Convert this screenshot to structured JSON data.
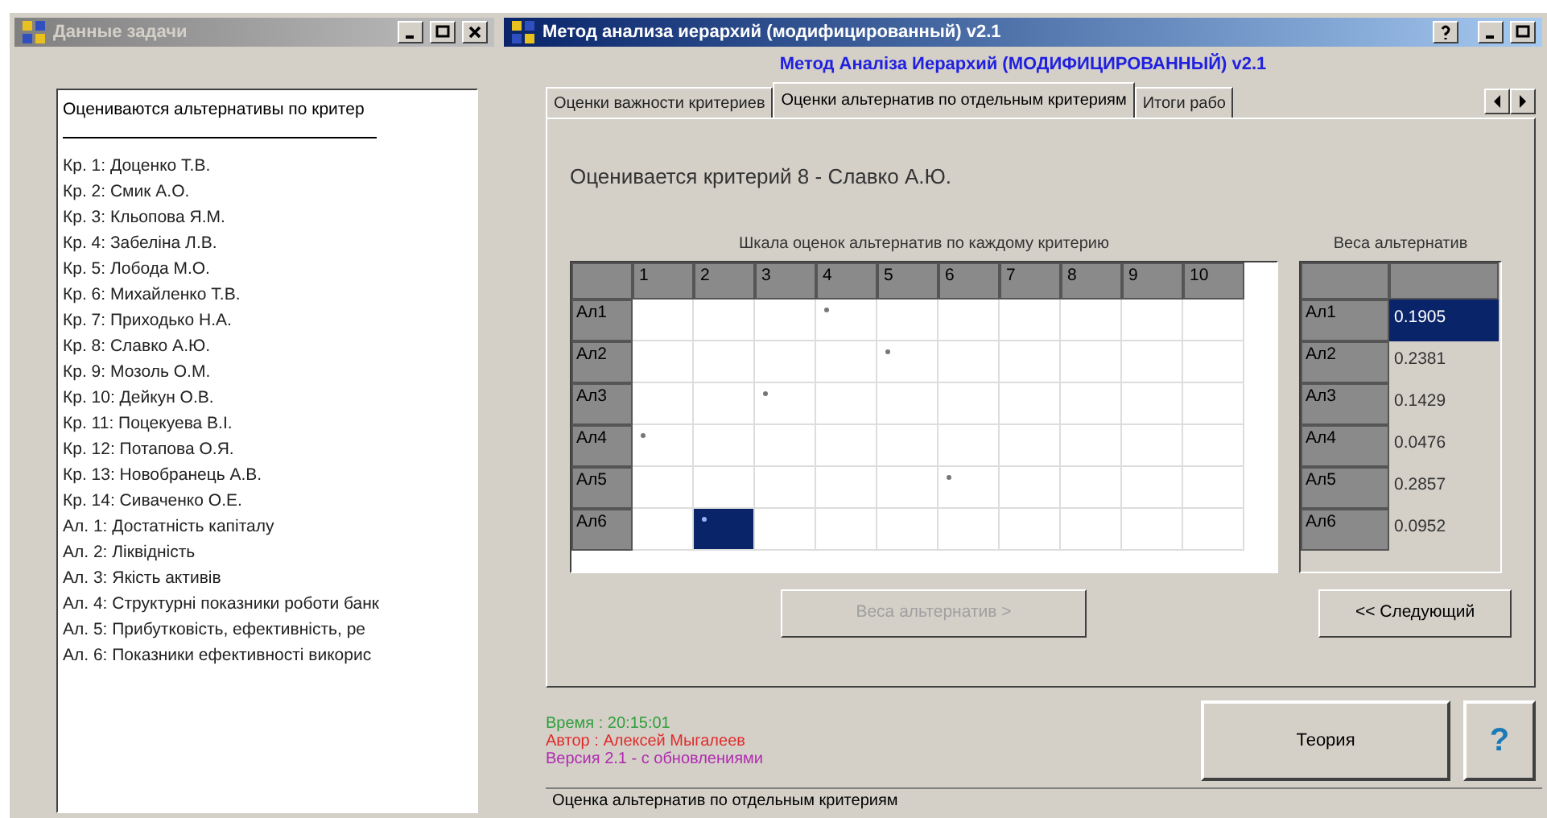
{
  "left_window": {
    "title": "Данные задачи",
    "active": false,
    "list_header": "Оцениваются альтернативы по критер",
    "items": [
      "Кр. 1: Доценко Т.В.",
      "Кр. 2: Смик А.О.",
      "Кр. 3: Кльопова Я.М.",
      "Кр. 4: Забеліна Л.В.",
      "Кр. 5: Лобода М.О.",
      "Кр. 6: Михайленко Т.В.",
      "Кр. 7: Приходько Н.А.",
      "Кр. 8: Славко А.Ю.",
      "Кр. 9: Мозоль О.М.",
      "Кр. 10: Дейкун О.В.",
      "Кр. 11: Поцекуева В.І.",
      "Кр. 12: Потапова О.Я.",
      "Кр. 13: Новобранець А.В.",
      "Кр. 14: Сиваченко О.Е.",
      "Ал. 1: Достатність капіталу",
      "Ал. 2: Ліквідність",
      "Ал. 3: Якість активів",
      "Ал. 4: Структурні показники роботи банк",
      "Ал. 5: Прибутковість, ефективність, ре",
      "Ал. 6: Показники ефективності викорис"
    ]
  },
  "main_window": {
    "title": "Метод анализа иерархий (модифицированный)  v2.1",
    "active": true,
    "heading": "Метод Аналіза Иерархий (МОДИФИЦИРОВАННЫЙ) v2.1",
    "tabs": [
      {
        "label": "Оценки важности критериев",
        "selected": false
      },
      {
        "label": "Оценки альтернатив по отдельным критериям",
        "selected": true
      },
      {
        "label": "Итоги рабо",
        "selected": false
      }
    ],
    "criterion_label": "Оценивается критерий 8 - Славко А.Ю.",
    "scale_grid": {
      "caption": "Шкала оценок альтернатив по каждому критерию",
      "columns": [
        "1",
        "2",
        "3",
        "4",
        "5",
        "6",
        "7",
        "8",
        "9",
        "10"
      ],
      "rows": [
        {
          "label": "Ал1",
          "cells": [
            {
              "mark": false,
              "selected": false
            },
            {
              "mark": false,
              "selected": false
            },
            {
              "mark": false,
              "selected": false
            },
            {
              "mark": true,
              "selected": false
            },
            {
              "mark": false,
              "selected": false
            },
            {
              "mark": false,
              "selected": false
            },
            {
              "mark": false,
              "selected": false
            },
            {
              "mark": false,
              "selected": false
            },
            {
              "mark": false,
              "selected": false
            },
            {
              "mark": false,
              "selected": false
            }
          ]
        },
        {
          "label": "Ал2",
          "cells": [
            {
              "mark": false,
              "selected": false
            },
            {
              "mark": false,
              "selected": false
            },
            {
              "mark": false,
              "selected": false
            },
            {
              "mark": false,
              "selected": false
            },
            {
              "mark": true,
              "selected": false
            },
            {
              "mark": false,
              "selected": false
            },
            {
              "mark": false,
              "selected": false
            },
            {
              "mark": false,
              "selected": false
            },
            {
              "mark": false,
              "selected": false
            },
            {
              "mark": false,
              "selected": false
            }
          ]
        },
        {
          "label": "Ал3",
          "cells": [
            {
              "mark": false,
              "selected": false
            },
            {
              "mark": false,
              "selected": false
            },
            {
              "mark": true,
              "selected": false
            },
            {
              "mark": false,
              "selected": false
            },
            {
              "mark": false,
              "selected": false
            },
            {
              "mark": false,
              "selected": false
            },
            {
              "mark": false,
              "selected": false
            },
            {
              "mark": false,
              "selected": false
            },
            {
              "mark": false,
              "selected": false
            },
            {
              "mark": false,
              "selected": false
            }
          ]
        },
        {
          "label": "Ал4",
          "cells": [
            {
              "mark": true,
              "selected": false
            },
            {
              "mark": false,
              "selected": false
            },
            {
              "mark": false,
              "selected": false
            },
            {
              "mark": false,
              "selected": false
            },
            {
              "mark": false,
              "selected": false
            },
            {
              "mark": false,
              "selected": false
            },
            {
              "mark": false,
              "selected": false
            },
            {
              "mark": false,
              "selected": false
            },
            {
              "mark": false,
              "selected": false
            },
            {
              "mark": false,
              "selected": false
            }
          ]
        },
        {
          "label": "Ал5",
          "cells": [
            {
              "mark": false,
              "selected": false
            },
            {
              "mark": false,
              "selected": false
            },
            {
              "mark": false,
              "selected": false
            },
            {
              "mark": false,
              "selected": false
            },
            {
              "mark": false,
              "selected": false
            },
            {
              "mark": true,
              "selected": false
            },
            {
              "mark": false,
              "selected": false
            },
            {
              "mark": false,
              "selected": false
            },
            {
              "mark": false,
              "selected": false
            },
            {
              "mark": false,
              "selected": false
            }
          ]
        },
        {
          "label": "Ал6",
          "cells": [
            {
              "mark": false,
              "selected": false
            },
            {
              "mark": true,
              "selected": true
            },
            {
              "mark": false,
              "selected": false
            },
            {
              "mark": false,
              "selected": false
            },
            {
              "mark": false,
              "selected": false
            },
            {
              "mark": false,
              "selected": false
            },
            {
              "mark": false,
              "selected": false
            },
            {
              "mark": false,
              "selected": false
            },
            {
              "mark": false,
              "selected": false
            },
            {
              "mark": false,
              "selected": false
            }
          ]
        }
      ]
    },
    "weights_grid": {
      "caption": "Веса альтернатив",
      "rows": [
        {
          "label": "Ал1",
          "value": "0.1905",
          "selected": true
        },
        {
          "label": "Ал2",
          "value": "0.2381",
          "selected": false
        },
        {
          "label": "Ал3",
          "value": "0.1429",
          "selected": false
        },
        {
          "label": "Ал4",
          "value": "0.0476",
          "selected": false
        },
        {
          "label": "Ал5",
          "value": "0.2857",
          "selected": false
        },
        {
          "label": "Ал6",
          "value": "0.0952",
          "selected": false
        }
      ]
    },
    "buttons": [
      {
        "label": "Веса альтернатив >",
        "disabled": true
      },
      {
        "label": "<< Следующий",
        "disabled": false
      }
    ],
    "info_lines": [
      {
        "text": "Время : 20:15:01",
        "color": "#2e9e3a"
      },
      {
        "text": "Автор : Алексей Мыгалеев",
        "color": "#e02a2a"
      },
      {
        "text": "Версия 2.1 - с обновлениями",
        "color": "#b02ab0"
      }
    ],
    "theory_button": "Теория",
    "help_button": "?",
    "status_bar": "Оценка альтернатив по отдельным критериям"
  }
}
